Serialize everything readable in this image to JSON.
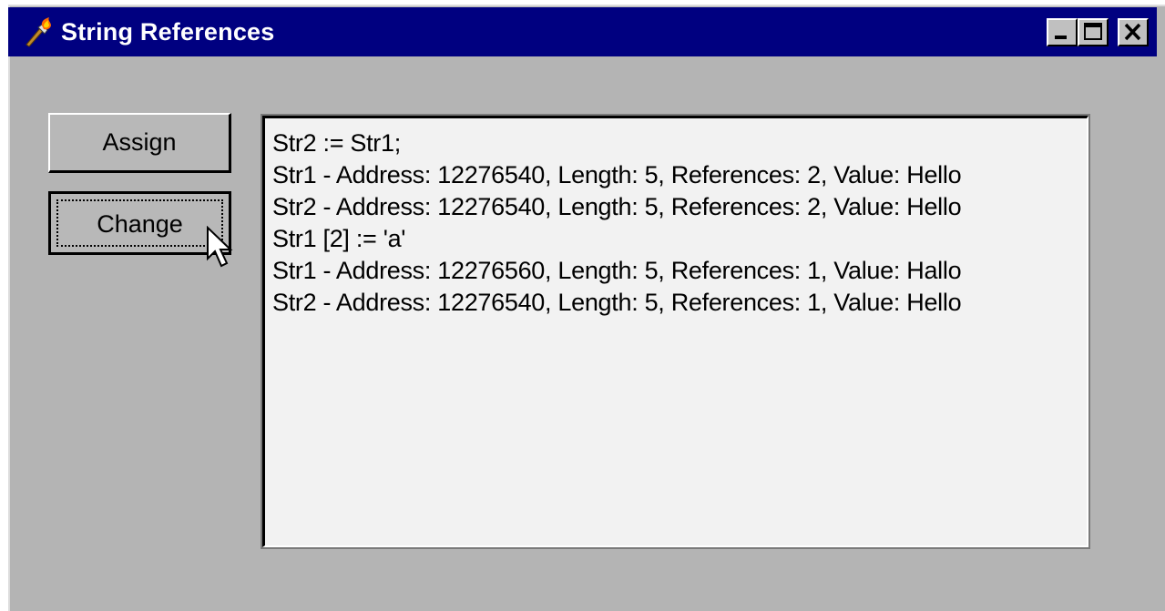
{
  "window": {
    "title": "String References",
    "controls": {
      "minimize": "minimize-icon",
      "maximize": "maximize-icon",
      "close": "close-icon"
    },
    "colors": {
      "titlebar": "#000080",
      "face": "#b4b4b4",
      "memo_bg": "#f2f2f2"
    }
  },
  "buttons": {
    "assign_label": "Assign",
    "change_label": "Change"
  },
  "memo": {
    "lines": [
      "Str2 := Str1;",
      "Str1 - Address: 12276540, Length: 5, References: 2, Value: Hello",
      "Str2 - Address: 12276540, Length: 5, References: 2, Value: Hello",
      "Str1 [2] := 'a'",
      "Str1 - Address: 12276560, Length: 5, References: 1, Value: Hallo",
      "Str2 - Address: 12276540, Length: 5, References: 1, Value: Hello"
    ]
  }
}
